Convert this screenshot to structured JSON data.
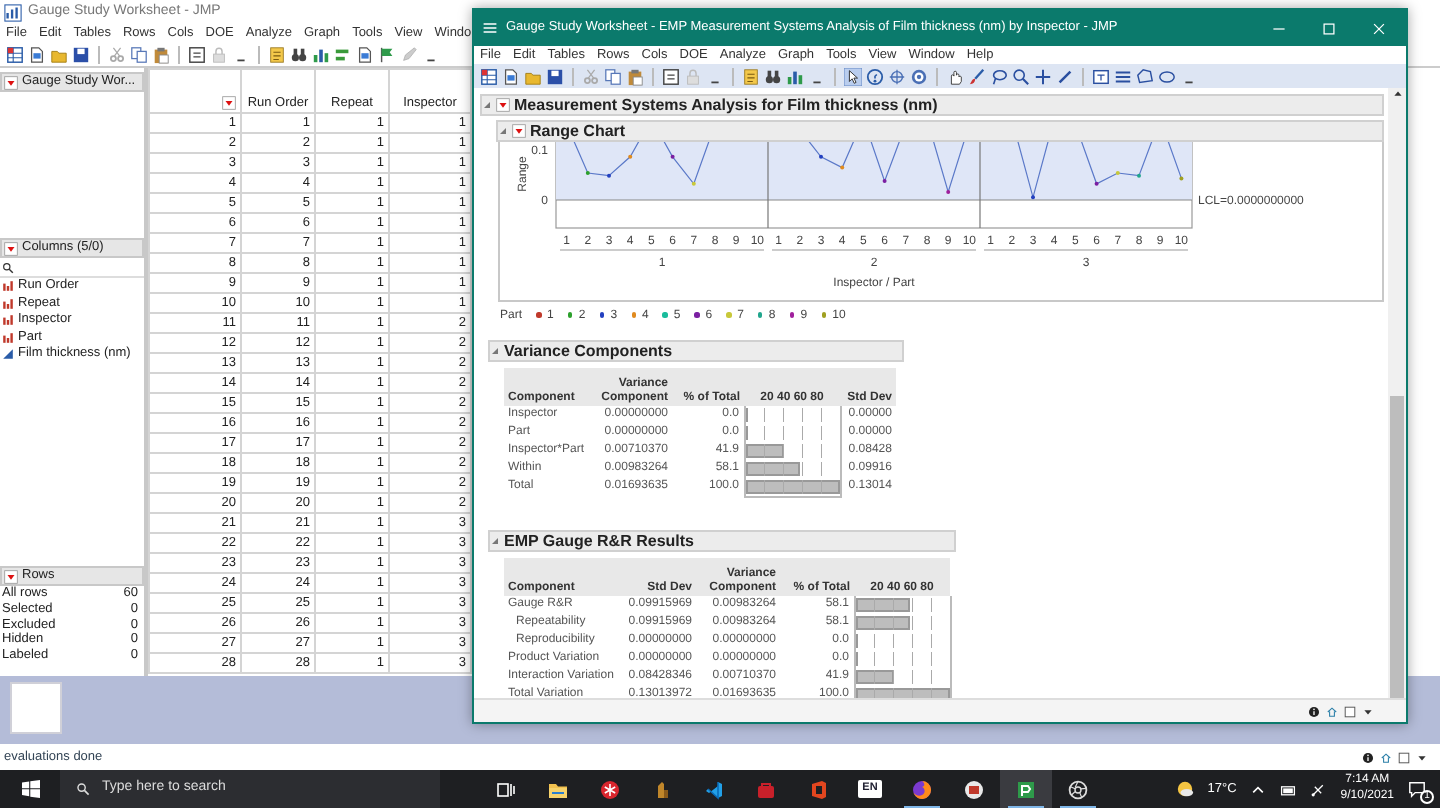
{
  "left_window": {
    "title": "Gauge Study Worksheet - JMP",
    "menu": [
      "File",
      "Edit",
      "Tables",
      "Rows",
      "Cols",
      "DOE",
      "Analyze",
      "Graph",
      "Tools",
      "View",
      "Windo"
    ],
    "table_panel": {
      "title": "Gauge Study Wor..."
    },
    "columns_panel": {
      "title": "Columns (5/0)",
      "items": [
        {
          "label": "Run Order",
          "kind": "nominal"
        },
        {
          "label": "Repeat",
          "kind": "nominal"
        },
        {
          "label": "Inspector",
          "kind": "nominal"
        },
        {
          "label": "Part",
          "kind": "nominal"
        },
        {
          "label": "Film thickness (nm)",
          "kind": "continuous"
        }
      ]
    },
    "rows_panel": {
      "title": "Rows",
      "items": [
        {
          "label": "All rows",
          "value": "60"
        },
        {
          "label": "Selected",
          "value": "0"
        },
        {
          "label": "Excluded",
          "value": "0"
        },
        {
          "label": "Hidden",
          "value": "0"
        },
        {
          "label": "Labeled",
          "value": "0"
        }
      ]
    },
    "table": {
      "columns": [
        "",
        "Run Order",
        "Repeat",
        "Inspector"
      ],
      "rows": [
        [
          "1",
          "1",
          "1",
          "1"
        ],
        [
          "2",
          "2",
          "1",
          "1"
        ],
        [
          "3",
          "3",
          "1",
          "1"
        ],
        [
          "4",
          "4",
          "1",
          "1"
        ],
        [
          "5",
          "5",
          "1",
          "1"
        ],
        [
          "6",
          "6",
          "1",
          "1"
        ],
        [
          "7",
          "7",
          "1",
          "1"
        ],
        [
          "8",
          "8",
          "1",
          "1"
        ],
        [
          "9",
          "9",
          "1",
          "1"
        ],
        [
          "10",
          "10",
          "1",
          "1"
        ],
        [
          "11",
          "11",
          "1",
          "2"
        ],
        [
          "12",
          "12",
          "1",
          "2"
        ],
        [
          "13",
          "13",
          "1",
          "2"
        ],
        [
          "14",
          "14",
          "1",
          "2"
        ],
        [
          "15",
          "15",
          "1",
          "2"
        ],
        [
          "16",
          "16",
          "1",
          "2"
        ],
        [
          "17",
          "17",
          "1",
          "2"
        ],
        [
          "18",
          "18",
          "1",
          "2"
        ],
        [
          "19",
          "19",
          "1",
          "2"
        ],
        [
          "20",
          "20",
          "1",
          "2"
        ],
        [
          "21",
          "21",
          "1",
          "3"
        ],
        [
          "22",
          "22",
          "1",
          "3"
        ],
        [
          "23",
          "23",
          "1",
          "3"
        ],
        [
          "24",
          "24",
          "1",
          "3"
        ],
        [
          "25",
          "25",
          "1",
          "3"
        ],
        [
          "26",
          "26",
          "1",
          "3"
        ],
        [
          "27",
          "27",
          "1",
          "3"
        ],
        [
          "28",
          "28",
          "1",
          "3"
        ]
      ]
    },
    "status": "evaluations done"
  },
  "report_window": {
    "title": "Gauge Study Worksheet - EMP Measurement Systems Analysis of Film thickness (nm) by Inspector - JMP",
    "menu": [
      "File",
      "Edit",
      "Tables",
      "Rows",
      "Cols",
      "DOE",
      "Analyze",
      "Graph",
      "Tools",
      "View",
      "Window",
      "Help"
    ],
    "outline_title": "Measurement Systems Analysis for Film thickness (nm)",
    "range_chart": {
      "title": "Range Chart",
      "y_axis_label": "Range",
      "y_tick_labels": [
        "0.1",
        "0"
      ],
      "lcl_label": "LCL=0.0000000000",
      "x_axis_label": "Inspector / Part",
      "groups": [
        {
          "label": "1",
          "parts": [
            "1",
            "2",
            "3",
            "4",
            "5",
            "6",
            "7",
            "8",
            "9",
            "10"
          ]
        },
        {
          "label": "2",
          "parts": [
            "1",
            "2",
            "3",
            "4",
            "5",
            "6",
            "7",
            "8",
            "9",
            "10"
          ]
        },
        {
          "label": "3",
          "parts": [
            "1",
            "2",
            "3",
            "4",
            "5",
            "6",
            "7",
            "8",
            "9",
            "10"
          ]
        }
      ]
    },
    "legend": {
      "title": "Part",
      "items": [
        {
          "label": "1",
          "color": "#c0392b"
        },
        {
          "label": "2",
          "color": "#2ca02c"
        },
        {
          "label": "3",
          "color": "#2340c0"
        },
        {
          "label": "4",
          "color": "#e08a1e"
        },
        {
          "label": "5",
          "color": "#1abc9c"
        },
        {
          "label": "6",
          "color": "#7b1fa2"
        },
        {
          "label": "7",
          "color": "#c8c83a"
        },
        {
          "label": "8",
          "color": "#21a68d"
        },
        {
          "label": "9",
          "color": "#a0209c"
        },
        {
          "label": "10",
          "color": "#a0a020"
        }
      ]
    },
    "variance_components": {
      "title": "Variance Components",
      "columns": [
        "Component",
        "Variance Component",
        "% of Total",
        "20 40 60 80",
        "Std Dev"
      ],
      "rows": [
        {
          "component": "Inspector",
          "variance_component": "0.00000000",
          "percent": "0.0",
          "level": 0,
          "std_dev": "0.00000"
        },
        {
          "component": "Part",
          "variance_component": "0.00000000",
          "percent": "0.0",
          "level": 0,
          "std_dev": "0.00000"
        },
        {
          "component": "Inspector*Part",
          "variance_component": "0.00710370",
          "percent": "41.9",
          "level": 0.419,
          "std_dev": "0.08428"
        },
        {
          "component": "Within",
          "variance_component": "0.00983264",
          "percent": "58.1",
          "level": 0.581,
          "std_dev": "0.09916"
        },
        {
          "component": "Total",
          "variance_component": "0.01693635",
          "percent": "100.0",
          "level": 1,
          "std_dev": "0.13014"
        }
      ]
    },
    "gauge_rr": {
      "title": "EMP Gauge R&R Results",
      "columns": [
        "Component",
        "Std Dev",
        "Variance Component",
        "% of Total",
        "20 40 60 80"
      ],
      "rows": [
        {
          "component": "Gauge R&R",
          "std_dev": "0.09915969",
          "variance_component": "0.00983264",
          "percent": "58.1",
          "level": 0.581,
          "children": [
            {
              "component": "Repeatability",
              "std_dev": "0.09915969",
              "variance_component": "0.00983264",
              "percent": "58.1",
              "level": 0.581
            },
            {
              "component": "Reproducibility",
              "std_dev": "0.00000000",
              "variance_component": "0.00000000",
              "percent": "0.0",
              "level": 0
            }
          ]
        },
        {
          "component": "Product Variation",
          "std_dev": "0.00000000",
          "variance_component": "0.00000000",
          "percent": "0.0",
          "level": 0
        },
        {
          "component": "Interaction Variation",
          "std_dev": "0.08428346",
          "variance_component": "0.00710370",
          "percent": "41.9",
          "level": 0.419
        },
        {
          "component": "Total Variation",
          "std_dev": "0.13013972",
          "variance_component": "0.01693635",
          "percent": "100.0",
          "level": 1
        }
      ]
    }
  },
  "taskbar": {
    "search_placeholder": "Type here to search",
    "apps": [
      {
        "kind": "task-view",
        "running": false,
        "selected": false
      },
      {
        "kind": "folder",
        "running": false,
        "selected": false
      },
      {
        "kind": "circle",
        "running": false,
        "selected": false
      },
      {
        "kind": "figure",
        "running": false,
        "selected": false
      },
      {
        "kind": "code",
        "running": false,
        "selected": false
      },
      {
        "kind": "bag",
        "running": false,
        "selected": false
      },
      {
        "kind": "office",
        "running": false,
        "selected": false
      },
      {
        "kind": "label",
        "label": "EN",
        "running": false,
        "selected": false
      },
      {
        "kind": "globe",
        "running": true,
        "selected": false
      },
      {
        "kind": "document",
        "running": false,
        "selected": false
      },
      {
        "kind": "chart",
        "running": true,
        "selected": true
      },
      {
        "kind": "aperture",
        "running": true,
        "selected": false
      }
    ],
    "temperature": "17°C",
    "time": "7:14 AM",
    "date": "9/10/2021",
    "notification_count": "1"
  }
}
